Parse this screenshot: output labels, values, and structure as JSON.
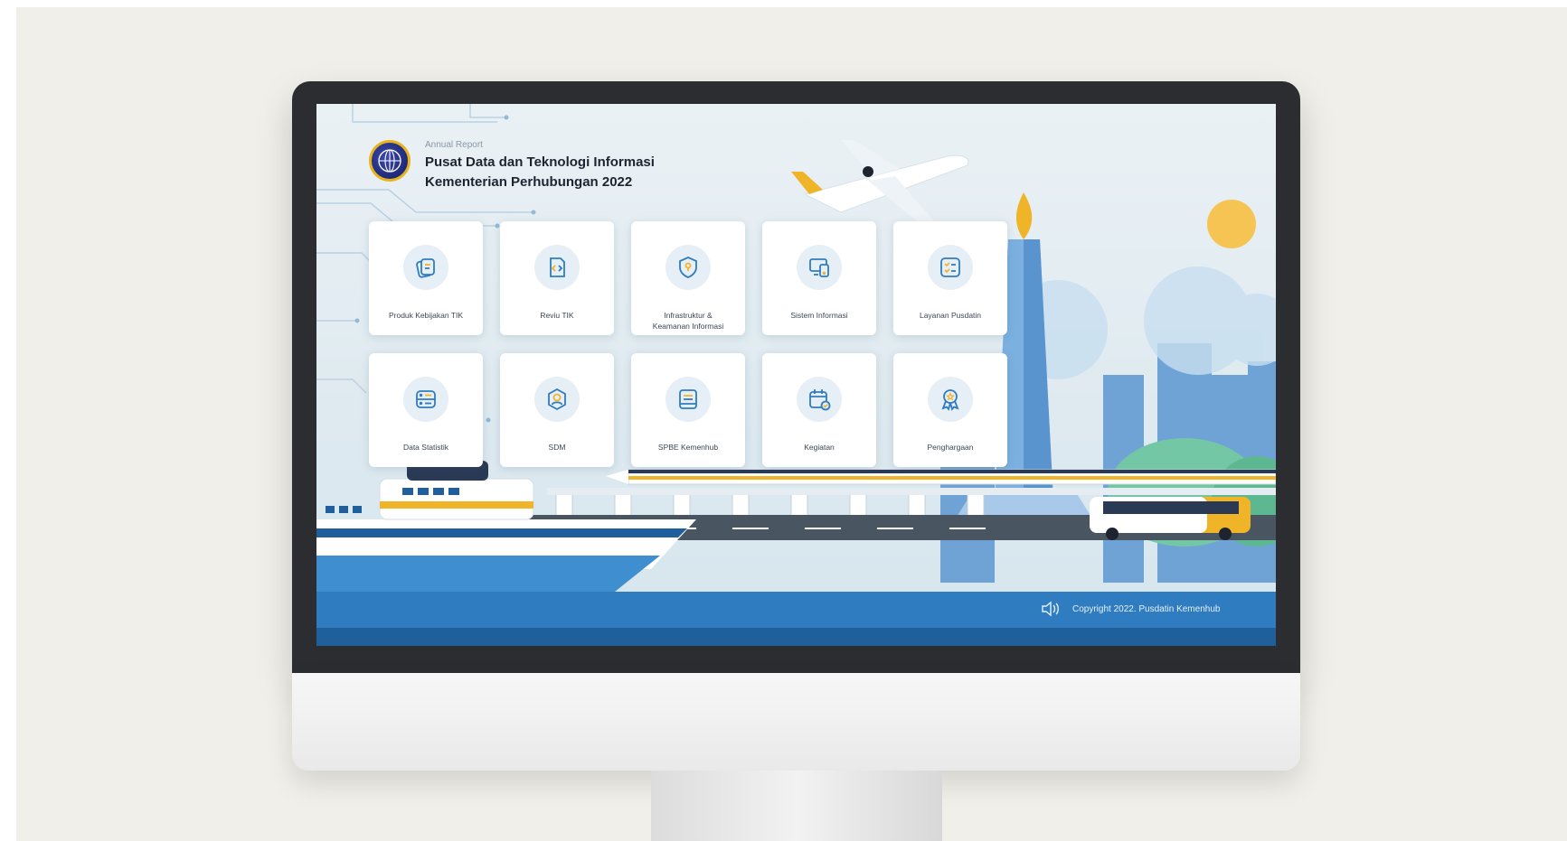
{
  "header": {
    "subtitle": "Annual Report",
    "title_line1": "Pusat Data dan Teknologi Informasi",
    "title_line2": "Kementerian Perhubungan 2022"
  },
  "menu": {
    "row1": [
      {
        "label": "Produk Kebijakan TIK",
        "icon": "document-stack-icon"
      },
      {
        "label": "Reviu TIK",
        "icon": "code-file-icon"
      },
      {
        "label_line1": "Infrastruktur &",
        "label_line2": "Keamanan Informasi",
        "icon": "shield-lock-icon"
      },
      {
        "label": "Sistem Informasi",
        "icon": "devices-icon"
      },
      {
        "label": "Layanan Pusdatin",
        "icon": "checklist-icon"
      }
    ],
    "row2": [
      {
        "label": "Data Statistik",
        "icon": "server-icon"
      },
      {
        "label": "SDM",
        "icon": "user-badge-icon"
      },
      {
        "label": "SPBE Kemenhub",
        "icon": "form-icon"
      },
      {
        "label": "Kegiatan",
        "icon": "calendar-check-icon"
      },
      {
        "label": "Penghargaan",
        "icon": "award-icon"
      }
    ]
  },
  "footer": {
    "copyright": "Copyright 2022. Pusdatin Kemenhub",
    "speaker_icon": "speaker-icon"
  },
  "colors": {
    "accent_blue": "#2f7cc0",
    "accent_yellow": "#f0b429",
    "navy": "#1e2a78"
  }
}
